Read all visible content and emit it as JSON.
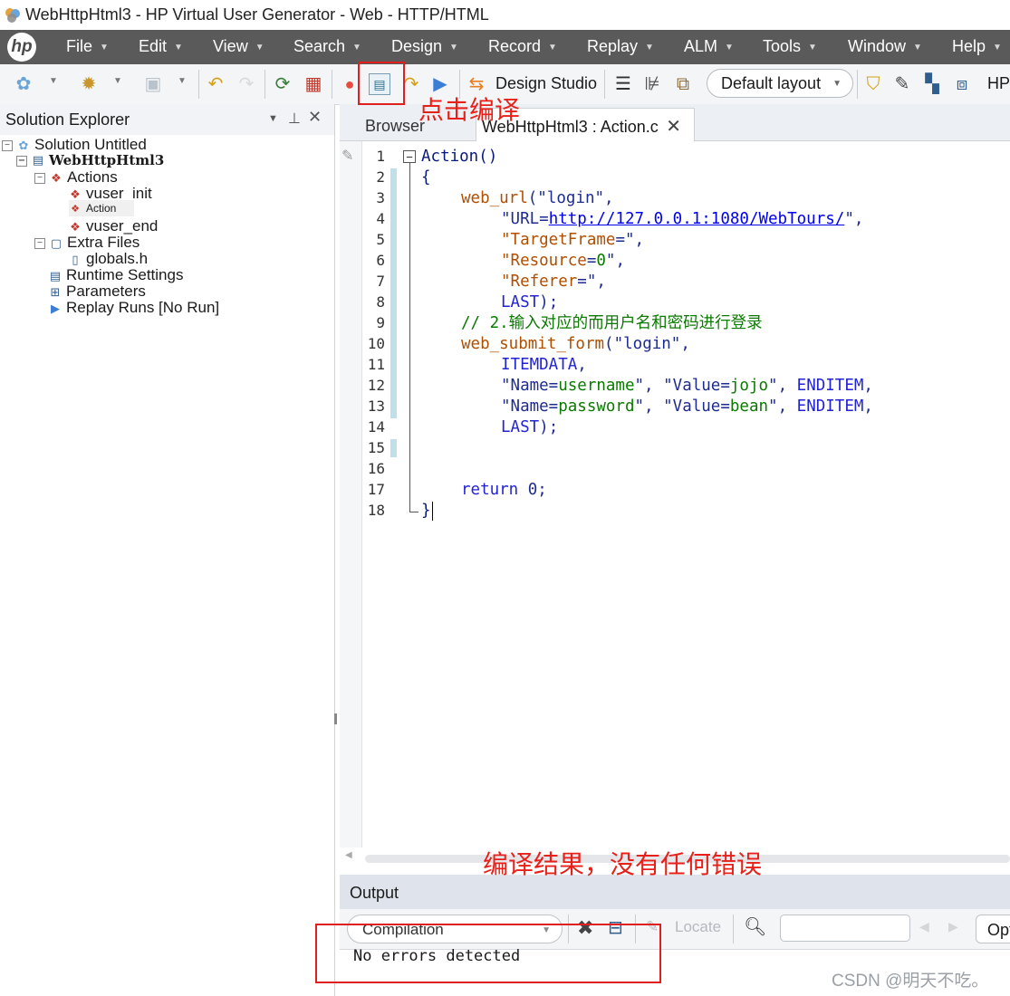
{
  "window": {
    "title": "WebHttpHtml3 - HP Virtual User Generator - Web - HTTP/HTML"
  },
  "menu": {
    "logo": "hp",
    "items": [
      "File",
      "Edit",
      "View",
      "Search",
      "Design",
      "Record",
      "Replay",
      "ALM",
      "Tools",
      "Window",
      "Help"
    ]
  },
  "toolbar": {
    "design_studio_label": "Design Studio",
    "layout_value": "Default layout",
    "hp_label": "HP"
  },
  "solution_explorer": {
    "title": "Solution Explorer",
    "tree": {
      "solution": "Solution Untitled",
      "script": "WebHttpHtml3",
      "actions": "Actions",
      "vuser_init": "vuser_init",
      "action": "Action",
      "vuser_end": "vuser_end",
      "extra_files": "Extra Files",
      "globals": "globals.h",
      "runtime_settings": "Runtime Settings",
      "parameters": "Parameters",
      "replay_runs": "Replay Runs [No Run]"
    }
  },
  "editor": {
    "tabs": {
      "browser": "Browser",
      "action": "WebHttpHtml3 : Action.c"
    },
    "line_numbers": [
      "1",
      "2",
      "3",
      "4",
      "5",
      "6",
      "7",
      "8",
      "9",
      "10",
      "11",
      "12",
      "13",
      "14",
      "15",
      "16",
      "17",
      "18"
    ],
    "code": {
      "l1": "Action()",
      "l2": "{",
      "l3a": "web_url",
      "l3b": "(\"login\",",
      "l4a": "\"URL=",
      "l4b": "http://127.0.0.1:1080/WebTours/",
      "l4c": "\",",
      "l5a": "\"TargetFrame",
      "l5b": "=\",",
      "l6a": "\"Resource",
      "l6b": "=",
      "l6c": "0",
      "l6d": "\",",
      "l7a": "\"Referer",
      "l7b": "=\",",
      "l8a": "LAST",
      "l8b": ");",
      "l9": "// 2.输入对应的而用户名和密码进行登录",
      "l10a": "web_submit_form",
      "l10b": "(\"login\",",
      "l11a": "ITEMDATA",
      "l11b": ",",
      "l12a": "\"Name=",
      "l12b": "username",
      "l12c": "\", ",
      "l12d": "\"Value=",
      "l12e": "jojo",
      "l12f": "\", ",
      "l12g": "ENDITEM",
      "l12h": ",",
      "l13a": "\"Name=",
      "l13b": "password",
      "l13c": "\", ",
      "l13d": "\"Value=",
      "l13e": "bean",
      "l13f": "\", ",
      "l13g": "ENDITEM",
      "l13h": ",",
      "l14a": "LAST",
      "l14b": ");",
      "l17a": "return",
      "l17b": " 0;",
      "l18": "}"
    }
  },
  "output": {
    "title": "Output",
    "filter_value": "Compilation",
    "locate_label": "Locate",
    "options_label": "Opt",
    "message": "No errors detected"
  },
  "annotations": {
    "click_compile": "点击编译",
    "compile_result": "编译结果，没有任何错误"
  },
  "watermark": "CSDN @明天不吃。",
  "colors": {
    "menu_bg": "#5a5a5a",
    "annotation_red": "#e02020",
    "change_bar": "#bfe0ea"
  }
}
